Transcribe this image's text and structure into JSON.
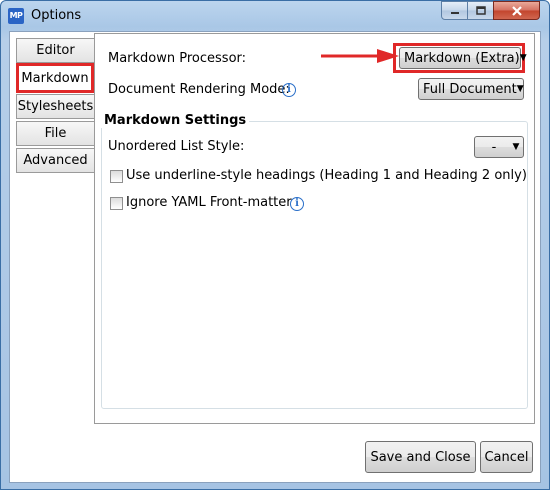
{
  "window": {
    "title": "Options",
    "app_icon_text": "MP"
  },
  "tabs": [
    {
      "label": "Editor",
      "active": false
    },
    {
      "label": "Markdown",
      "active": true
    },
    {
      "label": "Stylesheets",
      "active": false
    },
    {
      "label": "File",
      "active": false
    },
    {
      "label": "Advanced",
      "active": false
    }
  ],
  "markdown": {
    "processor_label": "Markdown Processor:",
    "processor_value": "Markdown (Extra)",
    "rendering_label": "Document Rendering Mode:",
    "rendering_value": "Full Document",
    "settings_title": "Markdown Settings",
    "list_style_label": "Unordered List Style:",
    "list_style_value": "-",
    "underline_headings_label": "Use underline-style headings (Heading 1 and Heading 2 only)",
    "underline_headings_checked": false,
    "ignore_yaml_label": "Ignore YAML Front-matter",
    "ignore_yaml_checked": false
  },
  "buttons": {
    "save_close": "Save and Close",
    "cancel": "Cancel"
  },
  "icons": {
    "info": "i",
    "dropdown_arrow": "▼"
  },
  "colors": {
    "highlight_red": "#e02828",
    "info_blue": "#2a6fc9"
  }
}
